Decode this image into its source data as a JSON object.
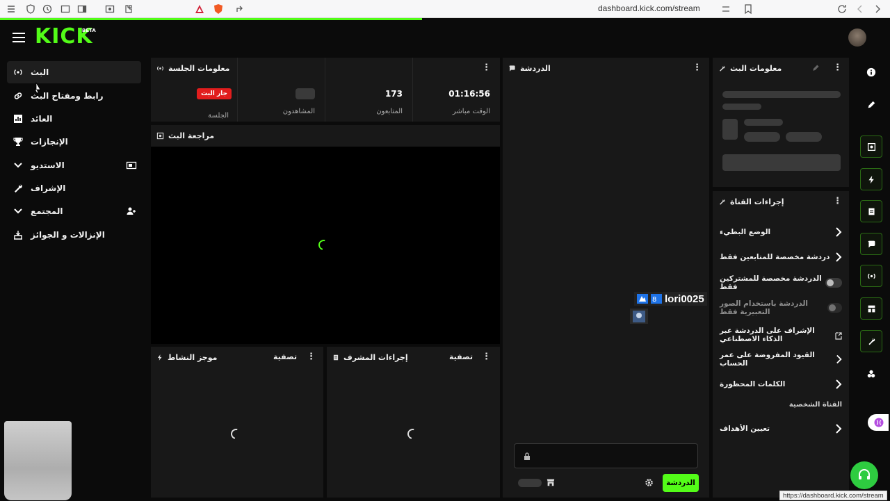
{
  "browser": {
    "url": "dashboard.kick.com/stream",
    "status_url": "https://dashboard.kick.com/stream"
  },
  "brand": {
    "logo": "KICK",
    "beta": "BETA",
    "accent_color": "#53fc18"
  },
  "sidebar": {
    "items": [
      {
        "label": "البث",
        "icon": "broadcast-icon"
      },
      {
        "label": "رابط ومفتاح البث",
        "icon": "link-icon"
      },
      {
        "label": "العائد",
        "icon": "chart-icon"
      },
      {
        "label": "الإنجازات",
        "icon": "trophy-icon"
      },
      {
        "label": "الاستديو",
        "icon": "studio-icon"
      },
      {
        "label": "الإشراف",
        "icon": "wrench-icon"
      },
      {
        "label": "المجتمع",
        "icon": "community-icon"
      },
      {
        "label": "الإنزالات و الجوائز",
        "icon": "drops-icon"
      }
    ]
  },
  "session": {
    "title": "معلومات الجلسة",
    "live_badge": "جار البث",
    "stats": [
      {
        "caption": "الجلسة"
      },
      {
        "caption": "المشاهدون"
      },
      {
        "value": "173",
        "caption": "المتابعون"
      },
      {
        "value": "01:16:56",
        "caption": "الوقت مباشر"
      }
    ]
  },
  "preview": {
    "title": "مراجعة البث"
  },
  "activity": {
    "title": "موجز النشاط",
    "filter": "تصفية"
  },
  "mod_actions": {
    "title": "إجراءات المشرف",
    "filter": "تصفية"
  },
  "chat": {
    "title": "الدردشة",
    "send_label": "الدردشة",
    "overlay_user": "lori0025"
  },
  "stream_info": {
    "title": "معلومات البث"
  },
  "channel_actions": {
    "title": "إجراءات القناة",
    "items": [
      {
        "label": "الوضع البطيء",
        "control": "chevron"
      },
      {
        "label": "دردشة مخصصة للمتابعين فقط",
        "control": "chevron"
      },
      {
        "label": "الدردشة مخصصة للمشتركين فقط",
        "control": "toggle"
      },
      {
        "label": "الدردشة باستخدام الصور التعبيرية فقط",
        "control": "toggle"
      },
      {
        "label": "الإشراف على الدردشة عبر الذكاء الاصطناعي",
        "control": "external"
      },
      {
        "label": "القيود المفروضة على عمر الحساب",
        "control": "chevron"
      },
      {
        "label": "الكلمات المحظورة",
        "control": "chevron"
      }
    ],
    "section": "القناة الشخصية",
    "goals": "تعيين الأهداف"
  }
}
